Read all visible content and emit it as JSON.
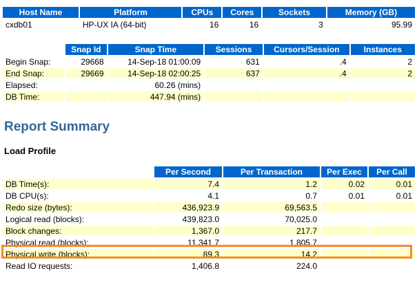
{
  "host": {
    "headers": [
      "Host Name",
      "Platform",
      "CPUs",
      "Cores",
      "Sockets",
      "Memory (GB)"
    ],
    "row": [
      "cxdb01",
      "HP-UX IA (64-bit)",
      "16",
      "16",
      "3",
      "95.99"
    ]
  },
  "snap": {
    "headers": [
      "Snap Id",
      "Snap Time",
      "Sessions",
      "Cursors/Session",
      "Instances"
    ],
    "rows": [
      {
        "label": "Begin Snap:",
        "id": "29668",
        "time": "14-Sep-18 01:00:09",
        "sessions": "631",
        "cursors": ".4",
        "instances": "2"
      },
      {
        "label": "End Snap:",
        "id": "29669",
        "time": "14-Sep-18 02:00:25",
        "sessions": "637",
        "cursors": ".4",
        "instances": "2"
      },
      {
        "label": "Elapsed:",
        "id": "",
        "time": "60.26 (mins)",
        "sessions": "",
        "cursors": "",
        "instances": ""
      },
      {
        "label": "DB Time:",
        "id": "",
        "time": "447.94 (mins)",
        "sessions": "",
        "cursors": "",
        "instances": ""
      }
    ]
  },
  "report": {
    "title": "Report Summary",
    "subtitle": "Load Profile"
  },
  "load": {
    "headers": [
      "Per Second",
      "Per Transaction",
      "Per Exec",
      "Per Call"
    ],
    "rows": [
      {
        "label": "DB Time(s):",
        "ps": "7.4",
        "pt": "1.2",
        "pe": "0.02",
        "pc": "0.01"
      },
      {
        "label": "DB CPU(s):",
        "ps": "4.1",
        "pt": "0.7",
        "pe": "0.01",
        "pc": "0.01"
      },
      {
        "label": "Redo size (bytes):",
        "ps": "436,923.9",
        "pt": "69,563.5",
        "pe": "",
        "pc": ""
      },
      {
        "label": "Logical read (blocks):",
        "ps": "439,823.0",
        "pt": "70,025.0",
        "pe": "",
        "pc": ""
      },
      {
        "label": "Block changes:",
        "ps": "1,367.0",
        "pt": "217.7",
        "pe": "",
        "pc": ""
      },
      {
        "label": "Physical read (blocks):",
        "ps": "11,341.7",
        "pt": "1,805.7",
        "pe": "",
        "pc": ""
      },
      {
        "label": "Physical write (blocks):",
        "ps": "89.3",
        "pt": "14.2",
        "pe": "",
        "pc": ""
      },
      {
        "label": "Read IO requests:",
        "ps": "1,406.8",
        "pt": "224.0",
        "pe": "",
        "pc": ""
      }
    ]
  },
  "colors": {
    "header_bg": "#0066CC",
    "row_highlight": "#FFFFCC",
    "title": "#336699",
    "annotation_box": "#F68B2A"
  }
}
